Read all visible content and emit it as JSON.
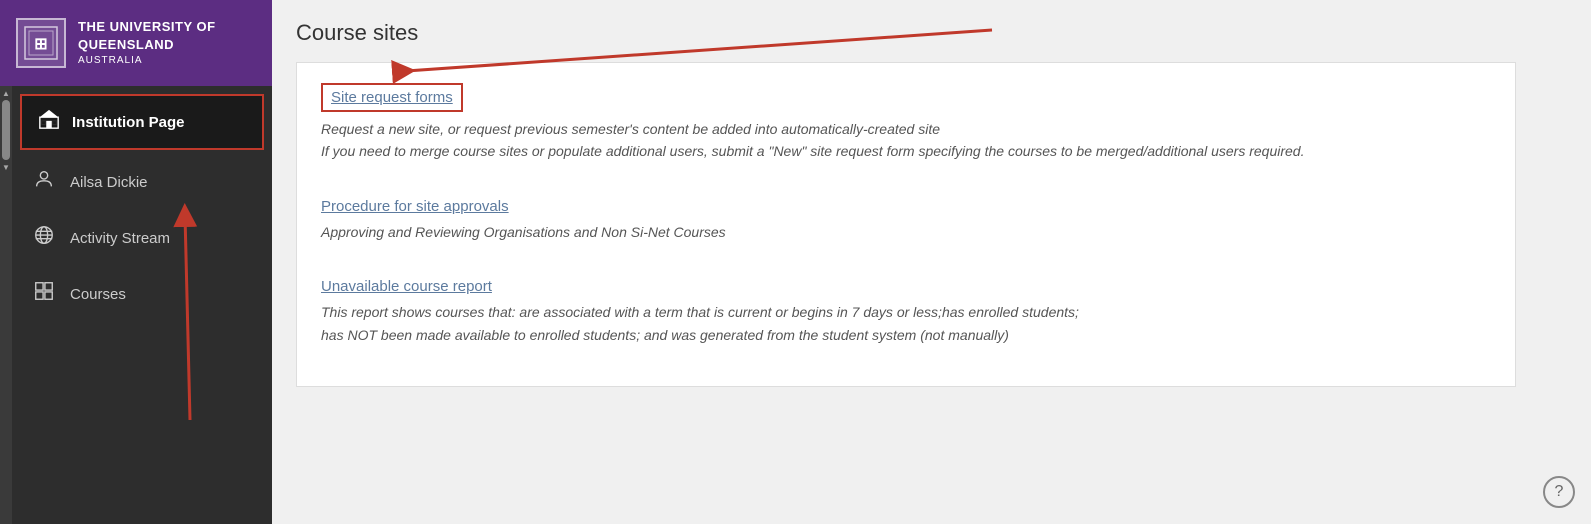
{
  "sidebar": {
    "logo": {
      "university_name": "The University Of Queensland",
      "country": "Australia"
    },
    "items": [
      {
        "label": "Institution Page",
        "icon": "🏛",
        "active": true
      },
      {
        "label": "Ailsa Dickie",
        "icon": "person"
      },
      {
        "label": "Activity Stream",
        "icon": "globe"
      },
      {
        "label": "Courses",
        "icon": "grid"
      }
    ]
  },
  "main": {
    "title": "Course sites",
    "sections": [
      {
        "link_text": "Site request forms",
        "description_line1": "Request a new site, or request previous semester's content be added into automatically-created site",
        "description_line2": "If you need to merge course sites or populate additional users, submit a \"New\" site request form specifying the courses to be merged/additional users required."
      },
      {
        "link_text": "Procedure for site approvals",
        "description_line1": "Approving and Reviewing Organisations and Non Si-Net Courses"
      },
      {
        "link_text": "Unavailable course report",
        "description_line1": "This report shows courses that: are associated with a term that is current or begins in 7 days or less;has enrolled students;",
        "description_line2": "has NOT been made available to enrolled students; and was generated from the student system (not manually)"
      }
    ]
  },
  "help": {
    "icon_label": "?"
  }
}
